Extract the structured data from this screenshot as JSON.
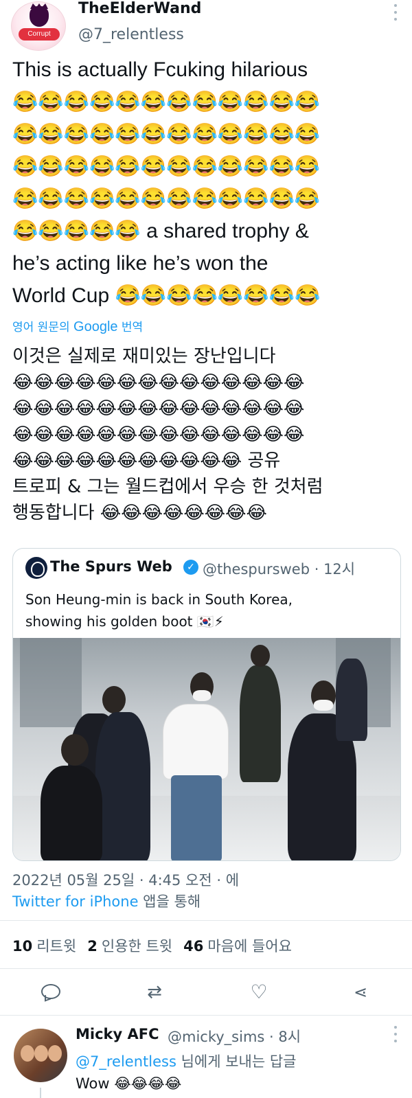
{
  "tweet": {
    "display_name": "TheElderWand",
    "handle": "@7_relentless",
    "avatar_badge": "Corrupt",
    "text": "This is actually Fcuking hilarious\n😂😂😂😂😂😂😂😂😂😂😂😂\n😂😂😂😂😂😂😂😂😂😂😂😂\n😂😂😂😂😂😂😂😂😂😂😂😂\n😂😂😂😂😂😂😂😂😂😂😂😂\n😂😂😂😂😂 a shared trophy &\nhe’s acting like he’s won the\nWorld Cup 😂😂😂😂😂😂😂😂",
    "translate_prefix": "영어 원문의 ",
    "translate_brand": "Google",
    "translate_suffix": " 번역",
    "translated_text": "이것은 실제로 재미있는 장난입니다\n😂😂😂😂😂😂😂😂😂😂😂😂😂😂\n😂😂😂😂😂😂😂😂😂😂😂😂😂😂\n😂😂😂😂😂😂😂😂😂😂😂😂😂😂\n😂😂😂😂😂😂😂😂😂😂😂 공유\n트로피 & 그는 월드컵에서 우승 한 것처럼\n행동합니다 😂😂😂😂😂😂😂😂",
    "timestamp": "2022년 05월 25일 · 4:45 오전 · 에",
    "source_app": "Twitter for iPhone",
    "source_suffix": " 앱을 통해"
  },
  "quote": {
    "name": "The Spurs Web",
    "verified_symbol": "✓",
    "meta": "@thespursweb · 12시",
    "text": "Son Heung-min is back in South Korea,\nshowing his golden boot 🇰🇷⚡"
  },
  "stats": {
    "retweets_count": "10",
    "retweets_label": "리트윗",
    "quotes_count": "2",
    "quotes_label": "인용한 트윗",
    "likes_count": "46",
    "likes_label": "마음에 들어요"
  },
  "actions": {
    "retweet_glyph": "⇄",
    "like_glyph": "♡",
    "share_glyph": "⋖"
  },
  "reply": {
    "name": "Micky AFC",
    "meta": "@micky_sims · 8시",
    "mention": "@7_relentless",
    "reply_to_suffix": " 님에게 보내는 답글",
    "text": "Wow 😂😂😂😂"
  }
}
